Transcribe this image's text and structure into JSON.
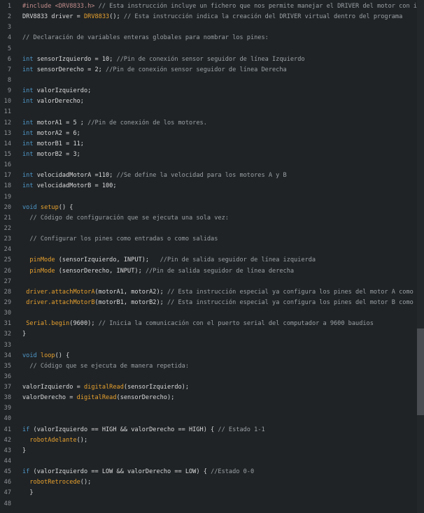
{
  "colors": {
    "background": "#1f2326",
    "line_number": "#8e9296",
    "keyword": "#4f98c9",
    "preprocessor": "#c28c8c",
    "function": "#e8a12e",
    "comment": "#9aa0a4",
    "text": "#dadada",
    "scrollbar_thumb": "#4a4e52"
  },
  "editor": {
    "lines": [
      {
        "n": "1",
        "tokens": [
          {
            "t": "pp",
            "v": "#include <DRV8833.h>"
          },
          {
            "t": "cm",
            "v": " // Esta instrucción incluye un fichero que nos permite manejar el DRIVER del motor con instrucciones"
          }
        ]
      },
      {
        "n": "2",
        "tokens": [
          {
            "t": "tx",
            "v": "DRV8833 driver = "
          },
          {
            "t": "fn",
            "v": "DRV8833"
          },
          {
            "t": "tx",
            "v": "(); "
          },
          {
            "t": "cm",
            "v": "// Esta instrucción indica la creación del DRIVER virtual dentro del programa"
          }
        ]
      },
      {
        "n": "3",
        "tokens": []
      },
      {
        "n": "4",
        "tokens": [
          {
            "t": "cm",
            "v": "// Declaración de variables enteras globales para nombrar los pines:"
          }
        ]
      },
      {
        "n": "5",
        "tokens": []
      },
      {
        "n": "6",
        "tokens": [
          {
            "t": "kw",
            "v": "int"
          },
          {
            "t": "tx",
            "v": " sensorIzquierdo = 10; "
          },
          {
            "t": "cm",
            "v": "//Pin de conexión sensor seguidor de línea Izquierdo"
          }
        ]
      },
      {
        "n": "7",
        "tokens": [
          {
            "t": "kw",
            "v": "int"
          },
          {
            "t": "tx",
            "v": " sensorDerecho = 2; "
          },
          {
            "t": "cm",
            "v": "//Pin de conexión sensor seguidor de línea Derecha"
          }
        ]
      },
      {
        "n": "8",
        "tokens": []
      },
      {
        "n": "9",
        "tokens": [
          {
            "t": "kw",
            "v": "int"
          },
          {
            "t": "tx",
            "v": " valorIzquierdo;"
          }
        ]
      },
      {
        "n": "10",
        "tokens": [
          {
            "t": "kw",
            "v": "int"
          },
          {
            "t": "tx",
            "v": " valorDerecho;"
          }
        ]
      },
      {
        "n": "11",
        "tokens": []
      },
      {
        "n": "12",
        "tokens": [
          {
            "t": "kw",
            "v": "int"
          },
          {
            "t": "tx",
            "v": " motorA1 = 5 ; "
          },
          {
            "t": "cm",
            "v": "//Pin de conexión de los motores."
          }
        ]
      },
      {
        "n": "13",
        "tokens": [
          {
            "t": "kw",
            "v": "int"
          },
          {
            "t": "tx",
            "v": " motorA2 = 6;"
          }
        ]
      },
      {
        "n": "14",
        "tokens": [
          {
            "t": "kw",
            "v": "int"
          },
          {
            "t": "tx",
            "v": " motorB1 = 11;"
          }
        ]
      },
      {
        "n": "15",
        "tokens": [
          {
            "t": "kw",
            "v": "int"
          },
          {
            "t": "tx",
            "v": " motorB2 = 3;"
          }
        ]
      },
      {
        "n": "16",
        "tokens": []
      },
      {
        "n": "17",
        "tokens": [
          {
            "t": "kw",
            "v": "int"
          },
          {
            "t": "tx",
            "v": " velocidadMotorA =110; "
          },
          {
            "t": "cm",
            "v": "//Se define la velocidad para los motores A y B"
          }
        ]
      },
      {
        "n": "18",
        "tokens": [
          {
            "t": "kw",
            "v": "int"
          },
          {
            "t": "tx",
            "v": " velocidadMotorB = 100;"
          }
        ]
      },
      {
        "n": "19",
        "tokens": []
      },
      {
        "n": "20",
        "tokens": [
          {
            "t": "kw",
            "v": "void"
          },
          {
            "t": "tx",
            "v": " "
          },
          {
            "t": "fn",
            "v": "setup"
          },
          {
            "t": "tx",
            "v": "() {"
          }
        ]
      },
      {
        "n": "21",
        "tokens": [
          {
            "t": "cm",
            "v": "  // Código de configuración que se ejecuta una sola vez:"
          }
        ]
      },
      {
        "n": "22",
        "tokens": []
      },
      {
        "n": "23",
        "tokens": [
          {
            "t": "cm",
            "v": "  // Configurar los pines como entradas o como salidas"
          }
        ]
      },
      {
        "n": "24",
        "tokens": []
      },
      {
        "n": "25",
        "tokens": [
          {
            "t": "tx",
            "v": "  "
          },
          {
            "t": "fn",
            "v": "pinMode"
          },
          {
            "t": "tx",
            "v": " (sensorIzquierdo, INPUT);   "
          },
          {
            "t": "cm",
            "v": "//Pin de salida seguidor de línea izquierda"
          }
        ]
      },
      {
        "n": "26",
        "tokens": [
          {
            "t": "tx",
            "v": "  "
          },
          {
            "t": "fn",
            "v": "pinMode"
          },
          {
            "t": "tx",
            "v": " (sensorDerecho, INPUT); "
          },
          {
            "t": "cm",
            "v": "//Pin de salida seguidor de línea derecha"
          }
        ]
      },
      {
        "n": "27",
        "tokens": []
      },
      {
        "n": "28",
        "tokens": [
          {
            "t": "tx",
            "v": " "
          },
          {
            "t": "fn",
            "v": "driver.attachMotorA"
          },
          {
            "t": "tx",
            "v": "(motorA1, motorA2); "
          },
          {
            "t": "cm",
            "v": "// Esta instrucción especial ya configura los pines del motor A como salidas"
          }
        ]
      },
      {
        "n": "29",
        "tokens": [
          {
            "t": "tx",
            "v": " "
          },
          {
            "t": "fn",
            "v": "driver.attachMotorB"
          },
          {
            "t": "tx",
            "v": "(motorB1, motorB2); "
          },
          {
            "t": "cm",
            "v": "// Esta instrucción especial ya configura los pines del motor B como salidas"
          }
        ]
      },
      {
        "n": "30",
        "tokens": []
      },
      {
        "n": "31",
        "tokens": [
          {
            "t": "tx",
            "v": " "
          },
          {
            "t": "fn",
            "v": "Serial.begin"
          },
          {
            "t": "tx",
            "v": "(9600); "
          },
          {
            "t": "cm",
            "v": "// Inicia la comunicación con el puerto serial del computador a 9600 baudios"
          }
        ]
      },
      {
        "n": "32",
        "tokens": [
          {
            "t": "tx",
            "v": "}"
          }
        ]
      },
      {
        "n": "33",
        "tokens": []
      },
      {
        "n": "34",
        "tokens": [
          {
            "t": "kw",
            "v": "void"
          },
          {
            "t": "tx",
            "v": " "
          },
          {
            "t": "fn",
            "v": "loop"
          },
          {
            "t": "tx",
            "v": "() {"
          }
        ]
      },
      {
        "n": "35",
        "tokens": [
          {
            "t": "cm",
            "v": "  // Código que se ejecuta de manera repetida:"
          }
        ]
      },
      {
        "n": "36",
        "tokens": []
      },
      {
        "n": "37",
        "tokens": [
          {
            "t": "tx",
            "v": "valorIzquierdo = "
          },
          {
            "t": "fn",
            "v": "digitalRead"
          },
          {
            "t": "tx",
            "v": "(sensorIzquierdo);"
          }
        ]
      },
      {
        "n": "38",
        "tokens": [
          {
            "t": "tx",
            "v": "valorDerecho = "
          },
          {
            "t": "fn",
            "v": "digitalRead"
          },
          {
            "t": "tx",
            "v": "(sensorDerecho);"
          }
        ]
      },
      {
        "n": "39",
        "tokens": []
      },
      {
        "n": "40",
        "tokens": []
      },
      {
        "n": "41",
        "tokens": [
          {
            "t": "kw",
            "v": "if"
          },
          {
            "t": "tx",
            "v": " (valorIzquierdo == HIGH && valorDerecho == HIGH) { "
          },
          {
            "t": "cm",
            "v": "// Estado 1-1"
          }
        ]
      },
      {
        "n": "42",
        "tokens": [
          {
            "t": "tx",
            "v": "  "
          },
          {
            "t": "fn",
            "v": "robotAdelante"
          },
          {
            "t": "tx",
            "v": "();"
          }
        ]
      },
      {
        "n": "43",
        "tokens": [
          {
            "t": "tx",
            "v": "}"
          }
        ]
      },
      {
        "n": "44",
        "tokens": []
      },
      {
        "n": "45",
        "tokens": [
          {
            "t": "kw",
            "v": "if"
          },
          {
            "t": "tx",
            "v": " (valorIzquierdo == LOW && valorDerecho == LOW) { "
          },
          {
            "t": "cm",
            "v": "//Estado 0-0"
          }
        ]
      },
      {
        "n": "46",
        "tokens": [
          {
            "t": "tx",
            "v": "  "
          },
          {
            "t": "fn",
            "v": "robotRetrocede"
          },
          {
            "t": "tx",
            "v": "();"
          }
        ]
      },
      {
        "n": "47",
        "tokens": [
          {
            "t": "tx",
            "v": "  }"
          }
        ]
      },
      {
        "n": "48",
        "tokens": []
      }
    ]
  }
}
